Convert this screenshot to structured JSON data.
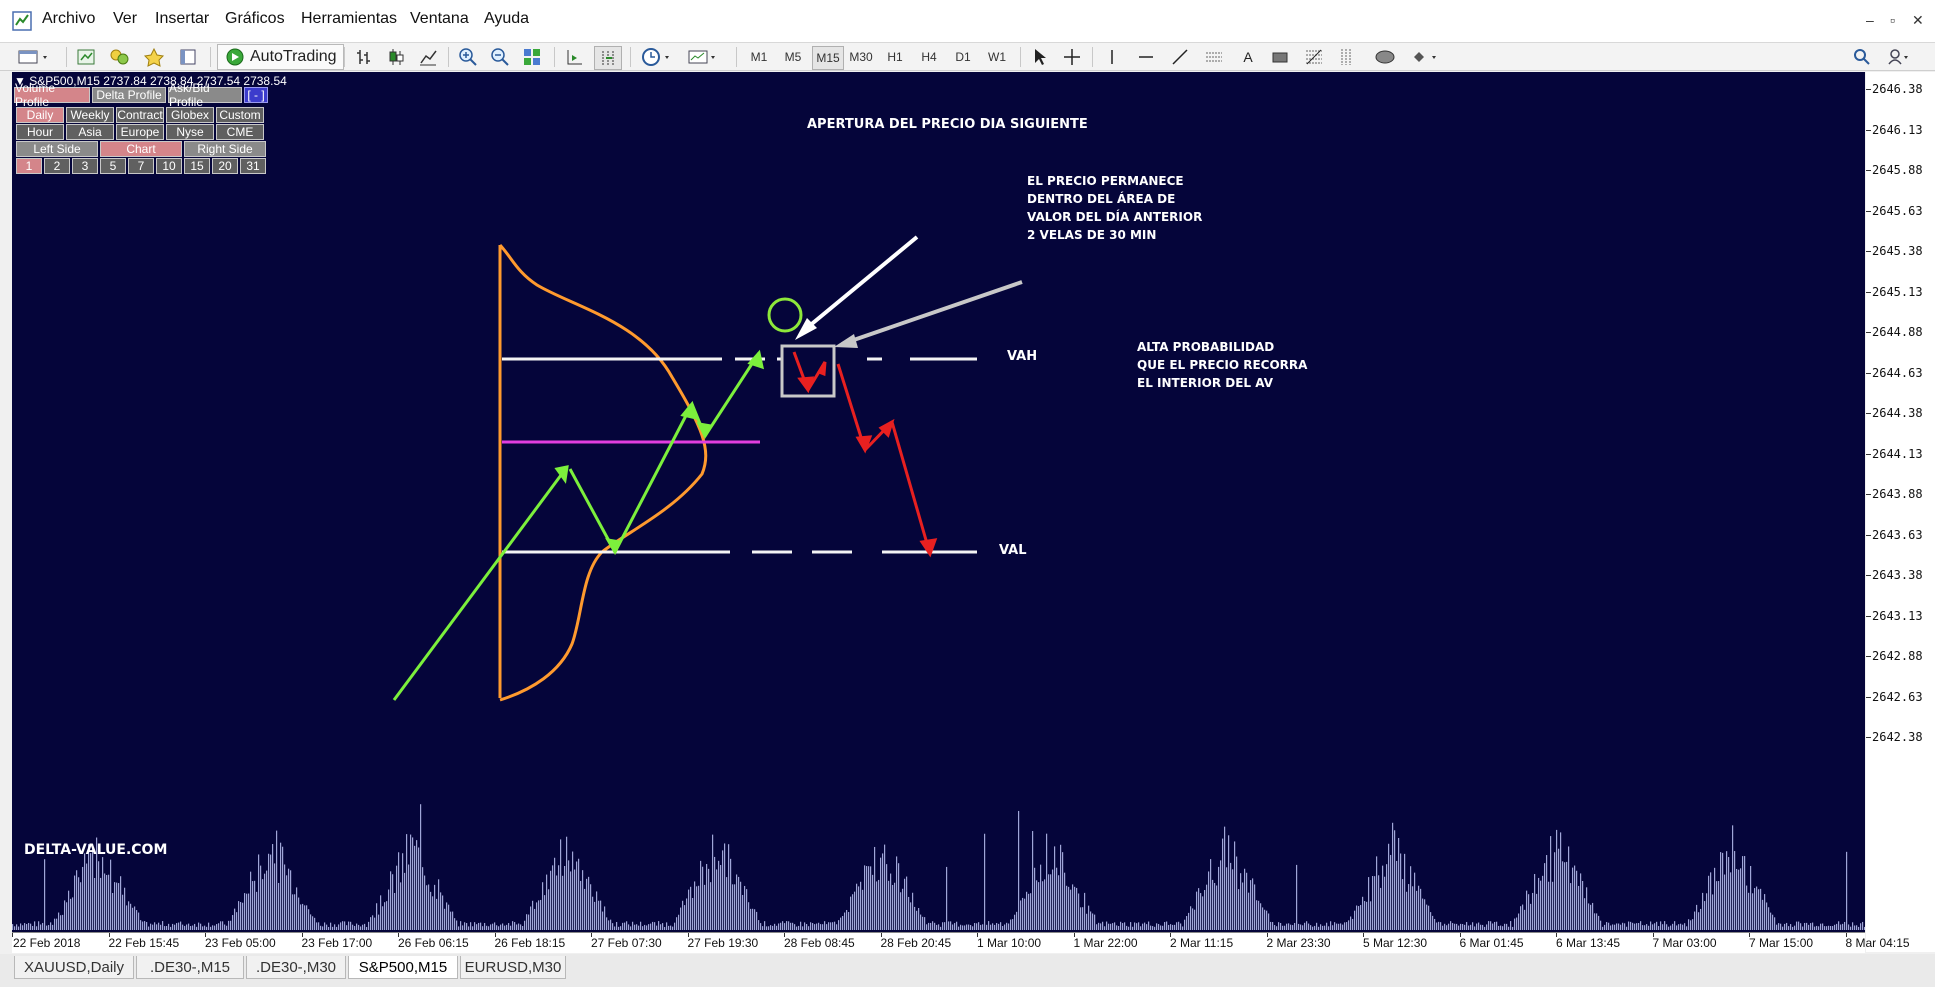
{
  "menu": {
    "items": [
      "Archivo",
      "Ver",
      "Insertar",
      "Gráficos",
      "Herramientas",
      "Ventana",
      "Ayuda"
    ]
  },
  "toolbar": {
    "autotrading_label": "AutoTrading",
    "timeframes": [
      "M1",
      "M5",
      "M15",
      "M30",
      "H1",
      "H4",
      "D1",
      "W1"
    ],
    "active_timeframe": "M15"
  },
  "chart": {
    "symbol_line": "S&P500,M15  2737.84 2738.84 2737.54 2738.54",
    "profile_buttons": [
      {
        "label": "Volume Profile",
        "state": "selected"
      },
      {
        "label": "Delta Profile",
        "state": "normal"
      },
      {
        "label": "Ask/Bid Profile",
        "state": "normal"
      },
      {
        "label": "[ - ]",
        "state": "blue"
      }
    ],
    "period_buttons": [
      {
        "label": "Daily",
        "state": "selected"
      },
      {
        "label": "Weekly",
        "state": "dark"
      },
      {
        "label": "Contract",
        "state": "dark"
      },
      {
        "label": "Globex",
        "state": "dark"
      },
      {
        "label": "Custom",
        "state": "dark"
      }
    ],
    "session_buttons": [
      {
        "label": "Hour",
        "state": "dark"
      },
      {
        "label": "Asia",
        "state": "dark"
      },
      {
        "label": "Europe",
        "state": "dark"
      },
      {
        "label": "Nyse",
        "state": "dark"
      },
      {
        "label": "CME",
        "state": "dark"
      }
    ],
    "side_buttons": [
      {
        "label": "Left Side",
        "state": "normal"
      },
      {
        "label": "Chart",
        "state": "selected"
      },
      {
        "label": "Right Side",
        "state": "normal"
      }
    ],
    "count_buttons": [
      {
        "label": "1",
        "state": "selected"
      },
      {
        "label": "2",
        "state": "dark"
      },
      {
        "label": "3",
        "state": "dark"
      },
      {
        "label": "5",
        "state": "dark"
      },
      {
        "label": "7",
        "state": "dark"
      },
      {
        "label": "10",
        "state": "dark"
      },
      {
        "label": "15",
        "state": "dark"
      },
      {
        "label": "20",
        "state": "dark"
      },
      {
        "label": "31",
        "state": "dark"
      }
    ],
    "annotations": {
      "apertura": "APERTURA DEL PRECIO DIA SIGUIENTE",
      "permanece": "EL PRECIO PERMANECE\nDENTRO DEL ÁREA DE\nVALOR DEL DÍA ANTERIOR\n2 VELAS DE 30 MIN",
      "vah": "VAH",
      "val": "VAL",
      "alta": "ALTA PROBABILIDAD\nQUE EL PRECIO RECORRA\nEL INTERIOR DEL AV"
    },
    "brand": "DELTA-VALUE.COM",
    "price_labels": [
      "2646.38",
      "2646.13",
      "2645.88",
      "2645.63",
      "2645.38",
      "2645.13",
      "2644.88",
      "2644.63",
      "2644.38",
      "2644.13",
      "2643.88",
      "2643.63",
      "2643.38",
      "2643.13",
      "2642.88",
      "2642.63",
      "2642.38"
    ],
    "time_labels": [
      "22 Feb 2018",
      "22 Feb 15:45",
      "23 Feb 05:00",
      "23 Feb 17:00",
      "26 Feb 06:15",
      "26 Feb 18:15",
      "27 Feb 07:30",
      "27 Feb 19:30",
      "28 Feb 08:45",
      "28 Feb 20:45",
      "1 Mar 10:00",
      "1 Mar 22:00",
      "2 Mar 11:15",
      "2 Mar 23:30",
      "5 Mar 12:30",
      "6 Mar 01:45",
      "6 Mar 13:45",
      "7 Mar 03:00",
      "7 Mar 15:00",
      "8 Mar 04:15"
    ],
    "colors": {
      "background": "#05053a",
      "volume": "#a0a6d8",
      "profile": "#ff9a2e",
      "poc": "#e23ee0",
      "green_arrow": "#7cf03c",
      "red_arrow": "#e82020",
      "open_circle": "#8ee83a",
      "box": "#c8c8c8"
    }
  },
  "tabs": [
    {
      "label": "XAUUSD,Daily",
      "active": false
    },
    {
      "label": ".DE30-,M15",
      "active": false
    },
    {
      "label": ".DE30-,M30",
      "active": false
    },
    {
      "label": "S&P500,M15",
      "active": true
    },
    {
      "label": "EURUSD,M30",
      "active": false
    }
  ]
}
